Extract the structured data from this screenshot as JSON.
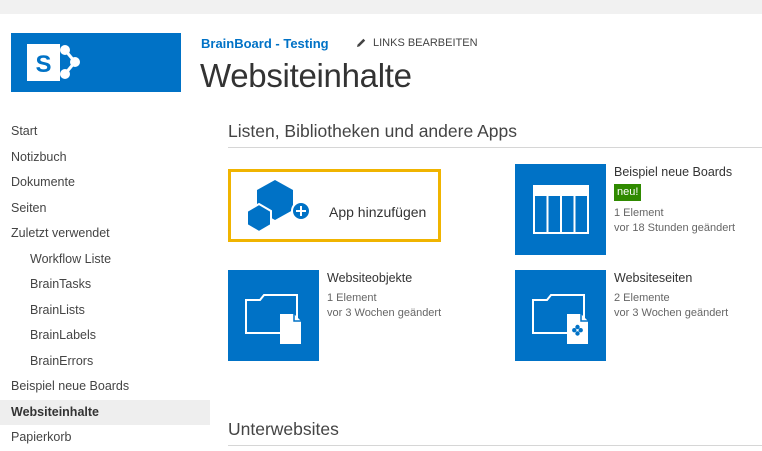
{
  "site": {
    "name": "BrainBoard - Testing",
    "edit_links_label": "LINKS BEARBEITEN"
  },
  "page": {
    "title": "Websiteinhalte"
  },
  "nav": {
    "items": [
      {
        "label": "Start",
        "level": 0,
        "selected": false
      },
      {
        "label": "Notizbuch",
        "level": 0,
        "selected": false
      },
      {
        "label": "Dokumente",
        "level": 0,
        "selected": false
      },
      {
        "label": "Seiten",
        "level": 0,
        "selected": false
      },
      {
        "label": "Zuletzt verwendet",
        "level": 0,
        "selected": false
      },
      {
        "label": "Workflow Liste",
        "level": 1,
        "selected": false
      },
      {
        "label": "BrainTasks",
        "level": 1,
        "selected": false
      },
      {
        "label": "BrainLists",
        "level": 1,
        "selected": false
      },
      {
        "label": "BrainLabels",
        "level": 1,
        "selected": false
      },
      {
        "label": "BrainErrors",
        "level": 1,
        "selected": false
      },
      {
        "label": "Beispiel neue Boards",
        "level": 0,
        "selected": false
      },
      {
        "label": "Websiteinhalte",
        "level": 0,
        "selected": true
      },
      {
        "label": "Papierkorb",
        "level": 0,
        "selected": false
      }
    ]
  },
  "sections": {
    "apps_header": "Listen, Bibliotheken und andere Apps",
    "subsites_header": "Unterwebsites"
  },
  "add_app": {
    "label": "App hinzufügen"
  },
  "tiles": [
    {
      "title": "Beispiel neue Boards",
      "badge": "neu!",
      "count": "1 Element",
      "modified": "vor 18 Stunden geändert",
      "icon": "list-icon"
    },
    {
      "title": "Websiteobjekte",
      "count": "1 Element",
      "modified": "vor 3 Wochen geändert",
      "icon": "folder-document-icon"
    },
    {
      "title": "Websiteseiten",
      "count": "2 Elemente",
      "modified": "vor 3 Wochen geändert",
      "icon": "folder-page-icon"
    }
  ],
  "colors": {
    "brand": "#0072c6",
    "highlight": "#f0b400",
    "badge": "#2f8a00",
    "nav_selected": "#eeeeee"
  }
}
